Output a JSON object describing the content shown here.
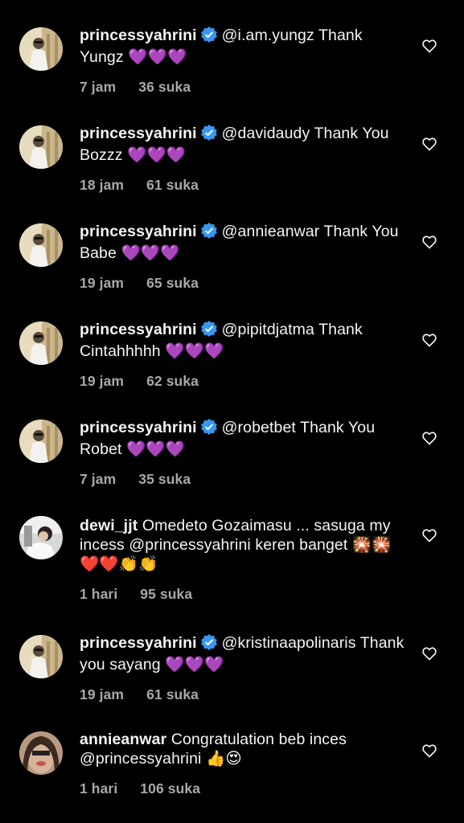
{
  "colors": {
    "background": "#000000",
    "text": "#f5f5f5",
    "meta": "#a8a8a8",
    "verified": "#3897f0",
    "purple_heart": "#a64dff"
  },
  "comments": [
    {
      "username": "princessyahrini",
      "verified": true,
      "text": "@i.am.yungz Thank Yungz 💜💜💜",
      "time": "7 jam",
      "likes": "36 suka",
      "avatar": "princessyahrini-avatar"
    },
    {
      "username": "princessyahrini",
      "verified": true,
      "text": "@davidaudy Thank You Bozzz 💜💜💜",
      "time": "18 jam",
      "likes": "61 suka",
      "avatar": "princessyahrini-avatar"
    },
    {
      "username": "princessyahrini",
      "verified": true,
      "text": "@annieanwar Thank You Babe 💜💜💜",
      "time": "19 jam",
      "likes": "65 suka",
      "avatar": "princessyahrini-avatar"
    },
    {
      "username": "princessyahrini",
      "verified": true,
      "text": "@pipitdjatma Thank Cintahhhhh 💜💜💜",
      "time": "19 jam",
      "likes": "62 suka",
      "avatar": "princessyahrini-avatar"
    },
    {
      "username": "princessyahrini",
      "verified": true,
      "text": "@robetbet Thank You Robet 💜💜💜",
      "time": "7 jam",
      "likes": "35 suka",
      "avatar": "princessyahrini-avatar"
    },
    {
      "username": "dewi_jjt",
      "verified": false,
      "text": "Omedeto Gozaimasu ... sasuga my incess @princessyahrini keren banget 🎇🎇❤️❤️👏👏",
      "time": "1 hari",
      "likes": "95 suka",
      "avatar": "dewi-jjt-avatar"
    },
    {
      "username": "princessyahrini",
      "verified": true,
      "text": "@kristinaapolinaris Thank you sayang 💜💜💜",
      "time": "19 jam",
      "likes": "61 suka",
      "avatar": "princessyahrini-avatar"
    },
    {
      "username": "annieanwar",
      "verified": false,
      "text": "Congratulation beb inces @princessyahrini 👍😍",
      "time": "1 hari",
      "likes": "106 suka",
      "avatar": "annieanwar-avatar"
    }
  ],
  "icons": {
    "like": "heart-outline-icon",
    "verified": "verified-badge-icon"
  }
}
